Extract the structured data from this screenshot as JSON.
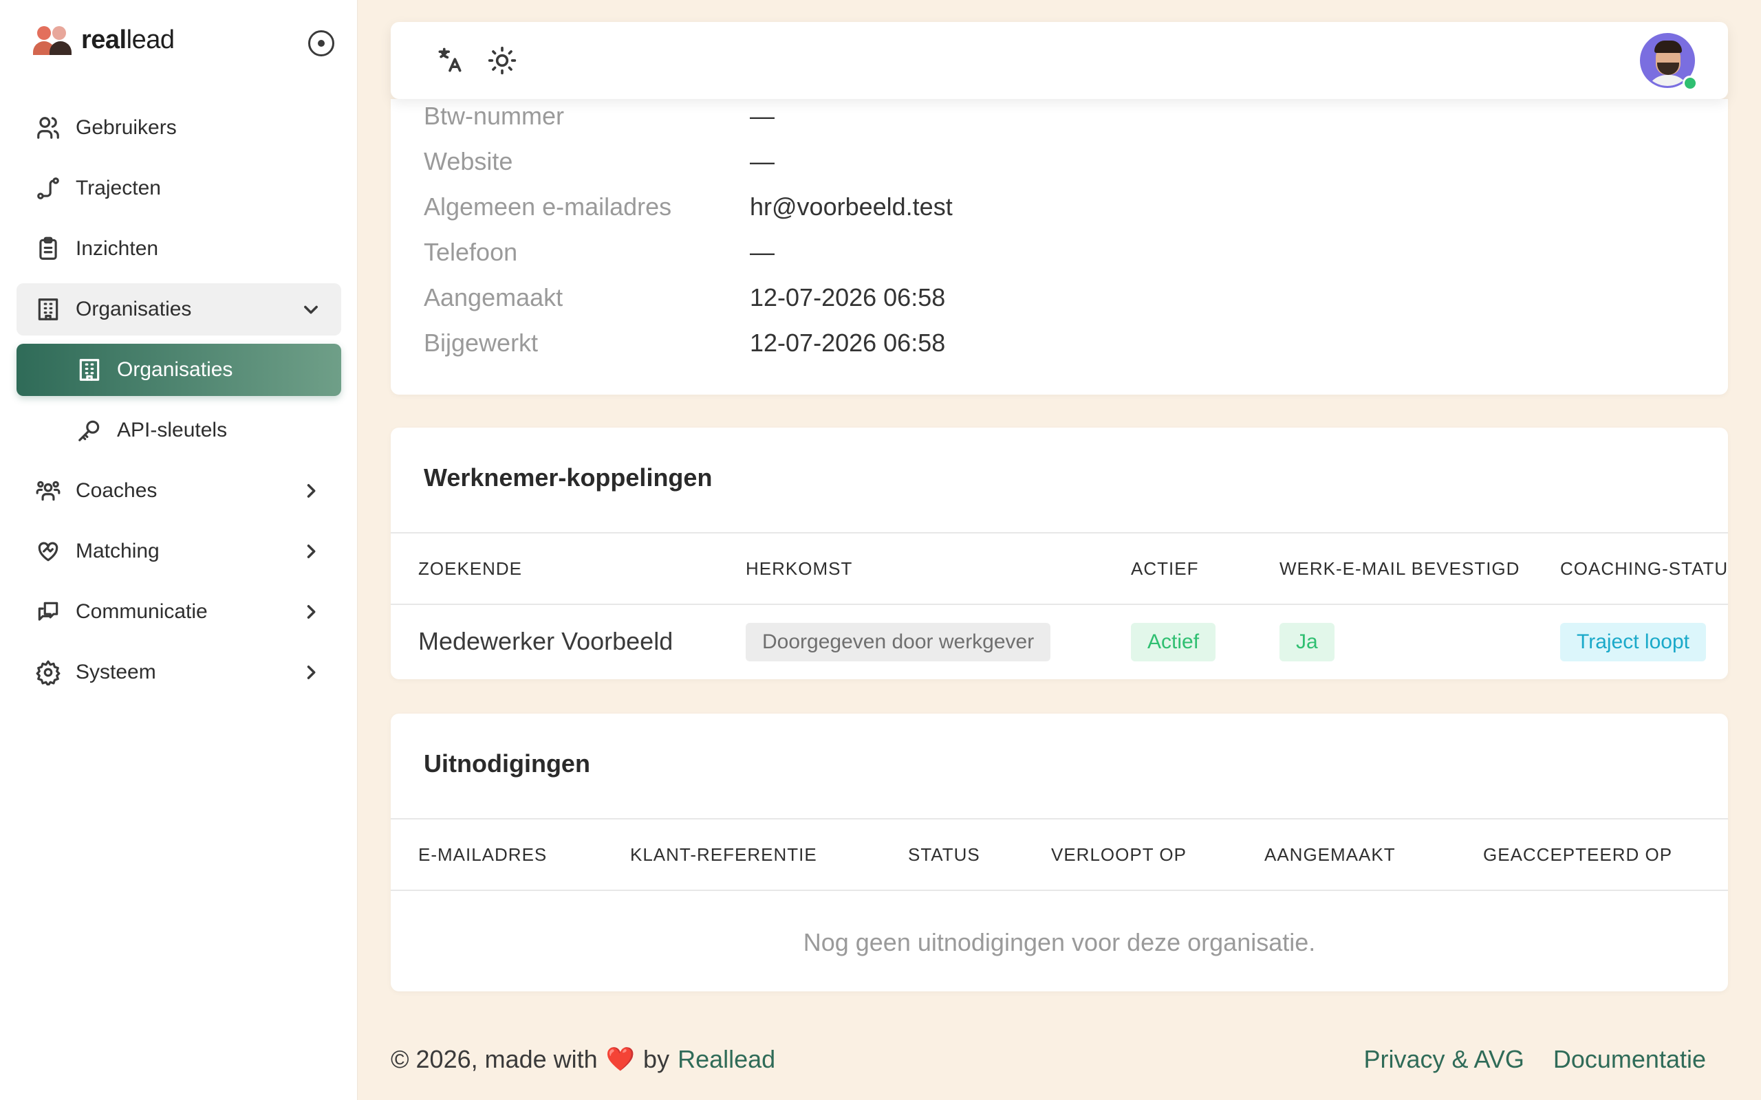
{
  "brand": {
    "name_bold": "real",
    "name_rest": "lead"
  },
  "sidebar": {
    "items": [
      {
        "label": "Gebruikers",
        "icon": "users-icon"
      },
      {
        "label": "Trajecten",
        "icon": "route-icon"
      },
      {
        "label": "Inzichten",
        "icon": "clipboard-icon"
      },
      {
        "label": "Organisaties",
        "icon": "building-icon",
        "expanded": true
      },
      {
        "label": "Organisaties",
        "icon": "building-icon",
        "active": true
      },
      {
        "label": "API-sleutels",
        "icon": "key-icon"
      },
      {
        "label": "Coaches",
        "icon": "coaches-icon"
      },
      {
        "label": "Matching",
        "icon": "heart-handshake-icon"
      },
      {
        "label": "Communicatie",
        "icon": "messages-icon"
      },
      {
        "label": "Systeem",
        "icon": "settings-icon"
      }
    ]
  },
  "details": {
    "rows": [
      {
        "label": "Btw-nummer",
        "value": "—"
      },
      {
        "label": "Website",
        "value": "—"
      },
      {
        "label": "Algemeen e-mailadres",
        "value": "hr@voorbeeld.test"
      },
      {
        "label": "Telefoon",
        "value": "—"
      },
      {
        "label": "Aangemaakt",
        "value": "12-07-2026 06:58"
      },
      {
        "label": "Bijgewerkt",
        "value": "12-07-2026 06:58"
      }
    ]
  },
  "koppelingen": {
    "title": "Werknemer-koppelingen",
    "headers": [
      "ZOEKENDE",
      "HERKOMST",
      "ACTIEF",
      "WERK-E-MAIL BEVESTIGD",
      "COACHING-STATUS"
    ],
    "rows": [
      {
        "zoekende": "Medewerker Voorbeeld",
        "herkomst": "Doorgegeven door werkgever",
        "actief": "Actief",
        "bevestigd": "Ja",
        "status": "Traject loopt"
      }
    ]
  },
  "uitnodigingen": {
    "title": "Uitnodigingen",
    "headers": [
      "E-MAILADRES",
      "KLANT-REFERENTIE",
      "STATUS",
      "VERLOOPT OP",
      "AANGEMAAKT",
      "GEACCEPTEERD OP"
    ],
    "empty": "Nog geen uitnodigingen voor deze organisatie."
  },
  "footer": {
    "prefix": "© 2026, made with",
    "heart": "❤️",
    "by": "by",
    "brand_link": "Reallead",
    "links": [
      "Privacy & AVG",
      "Documentatie"
    ]
  },
  "colors": {
    "accent": "#2f6b58",
    "background": "#faf0e3",
    "success": "#2fbf71",
    "info": "#1aa9c9"
  }
}
